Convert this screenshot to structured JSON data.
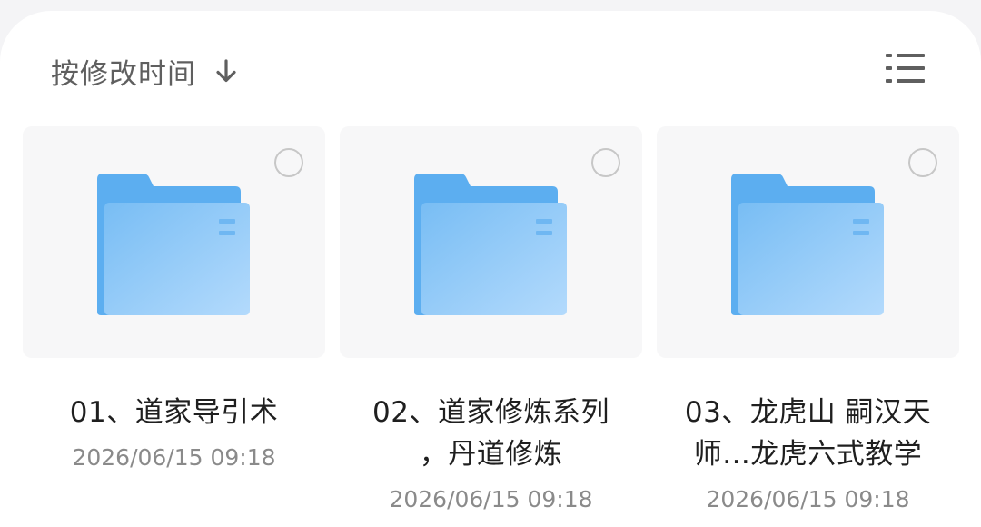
{
  "sort": {
    "label": "按修改时间",
    "direction_icon": "arrow-down-icon"
  },
  "view_toggle": {
    "icon": "list-view-icon"
  },
  "folders": [
    {
      "name_lines": [
        "01、道家导引术"
      ],
      "modified": "2026/06/15 09:18",
      "selected": false
    },
    {
      "name_lines": [
        "02、道家修炼系列",
        "，丹道修炼"
      ],
      "modified": "2026/06/15 09:18",
      "selected": false
    },
    {
      "name_lines": [
        "03、龙虎山 嗣汉天",
        "师...龙虎六式教学"
      ],
      "modified": "2026/06/15 09:18",
      "selected": false
    }
  ],
  "colors": {
    "folder_back": "#5caef0",
    "folder_front_start": "#78bdf4",
    "folder_front_end": "#b3dafc",
    "date_text": "#8a8a8a",
    "name_text": "#1f1f1f"
  }
}
